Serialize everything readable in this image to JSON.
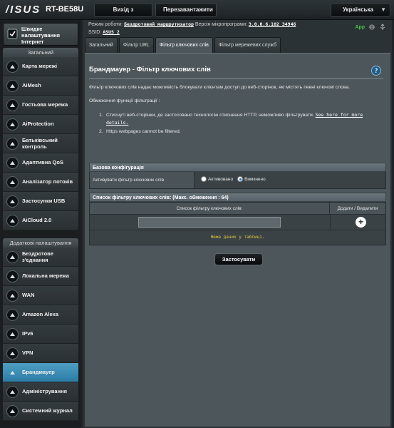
{
  "header": {
    "brand": "/ISUS",
    "model": "RT-BE58U",
    "logout_label": "Вихід з системи",
    "reboot_label": "Перезавантажити",
    "language": "Українська"
  },
  "status": {
    "mode_label": "Режим роботи:",
    "mode_value": "Бездротовий маршрутизатор",
    "fw_label": "Версія мікропрограми:",
    "fw_value": "3.0.0.6.102_34946",
    "ssid_label": "SSID:",
    "ssid_value": "ASUS_2",
    "app_label": "App"
  },
  "sidebar": {
    "quick_setup": "Швидке налаштування Інтернет",
    "general_title": "Загальний",
    "general_items": [
      {
        "label": "Карта мережі",
        "icon": "network-map-icon"
      },
      {
        "label": "AiMesh",
        "icon": "aimesh-icon"
      },
      {
        "label": "Гостьова мережа",
        "icon": "guest-network-icon"
      },
      {
        "label": "AiProtection",
        "icon": "aiprotection-icon"
      },
      {
        "label": "Батьківський контроль",
        "icon": "parental-control-icon"
      },
      {
        "label": "Адаптивна QoS",
        "icon": "qos-icon"
      },
      {
        "label": "Аналізатор потоків",
        "icon": "traffic-analyzer-icon"
      },
      {
        "label": "Застосунки USB",
        "icon": "usb-icon"
      },
      {
        "label": "AiCloud 2.0",
        "icon": "aicloud-icon"
      }
    ],
    "advanced_title": "Додаткові налаштування",
    "advanced_items": [
      {
        "label": "Бездротове з'єднання",
        "icon": "wireless-icon"
      },
      {
        "label": "Локальна мережа",
        "icon": "lan-icon"
      },
      {
        "label": "WAN",
        "icon": "wan-icon"
      },
      {
        "label": "Amazon Alexa",
        "icon": "alexa-icon"
      },
      {
        "label": "IPv6",
        "icon": "ipv6-icon"
      },
      {
        "label": "VPN",
        "icon": "vpn-icon"
      },
      {
        "label": "Брандмауер",
        "icon": "firewall-icon",
        "active": true
      },
      {
        "label": "Адміністрування",
        "icon": "administration-icon"
      },
      {
        "label": "Системний журнал",
        "icon": "system-log-icon"
      }
    ]
  },
  "tabs": [
    {
      "label": "Загальний"
    },
    {
      "label": "Фільтр URL"
    },
    {
      "label": "Фільтр ключових слів",
      "active": true
    },
    {
      "label": "Фільтр мережевих служб"
    }
  ],
  "page": {
    "title": "Брандмауер - Фільтр ключових слів",
    "description": "Фільтр ключових слів надає можливість блокувати клієнтам доступ до веб-сторінок, які містять певні ключові слова.",
    "limits_title": "Обмеження функції фільтрації :",
    "limit1_text": "Стиснуті веб-сторінки, де застосовано технологію стиснення HTTP, неможливо фільтрувати.",
    "limit1_link": "See here for more details.",
    "limit2_text": "Https webpages cannot be filtered.",
    "basic_config_title": "Базова конфігурація",
    "enable_label": "Активувати фільтр ключових слів",
    "radio_on": "Активовано",
    "radio_off": "Вимкнено",
    "list_title": "Список фільтру ключових слів: (Макс. обмеження : 64)",
    "col_keyword": "Список фільтру ключових слів:",
    "col_action": "Додати / Видалити",
    "add_symbol": "+",
    "empty_text": "Нема даних у таблиці.",
    "apply_label": "Застосувати"
  }
}
